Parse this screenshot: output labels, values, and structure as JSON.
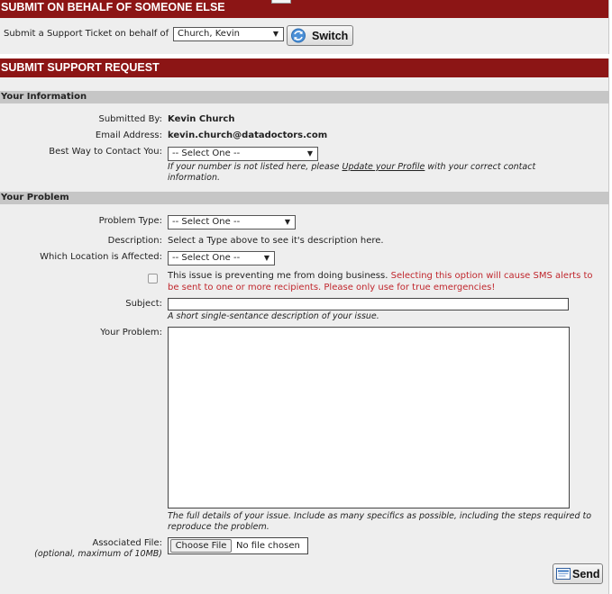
{
  "on_behalf": {
    "header": "SUBMIT ON BEHALF OF SOMEONE ELSE",
    "label": "Submit a Support Ticket on behalf of",
    "selected_user": "Church, Kevin",
    "switch_label": "Switch",
    "switch_icon": "refresh-icon"
  },
  "support_request": {
    "header": "SUBMIT SUPPORT REQUEST"
  },
  "your_information": {
    "title": "Your Information",
    "submitted_by_label": "Submitted By:",
    "submitted_by_value": "Kevin Church",
    "email_label": "Email Address:",
    "email_value": "kevin.church@datadoctors.com",
    "contact_label": "Best Way to Contact You:",
    "contact_selected": "-- Select One --",
    "contact_note_before": "If your number is not listed here, please",
    "contact_note_link": "Update your Profile",
    "contact_note_after": "with your correct contact information."
  },
  "your_problem": {
    "title": "Your Problem",
    "problem_type_label": "Problem Type:",
    "problem_type_selected": "-- Select One --",
    "description_label": "Description:",
    "description_value": "Select a Type above to see it's description here.",
    "location_label": "Which Location is Affected:",
    "location_selected": "-- Select One --",
    "business_text": "This issue is preventing me from doing business.",
    "business_warning": "Selecting this option will cause SMS alerts to be sent to one or more recipients. Please only use for true emergencies!",
    "subject_label": "Subject:",
    "subject_value": "",
    "subject_note": "A short single-sentance description of your issue.",
    "problem_label": "Your Problem:",
    "problem_value": "",
    "problem_note": "The full details of your issue. Include as many specifics as possible, including the steps required to reproduce the problem.",
    "file_label": "Associated File:",
    "file_note": "(optional, maximum of 10MB)",
    "file_button": "Choose File",
    "file_status": "No file chosen",
    "send_label": "Send",
    "send_icon": "envelope-icon"
  },
  "colors": {
    "header_bar": "#8c1515",
    "section_bar": "#c6c6c6",
    "warning_text": "#c0272d"
  }
}
